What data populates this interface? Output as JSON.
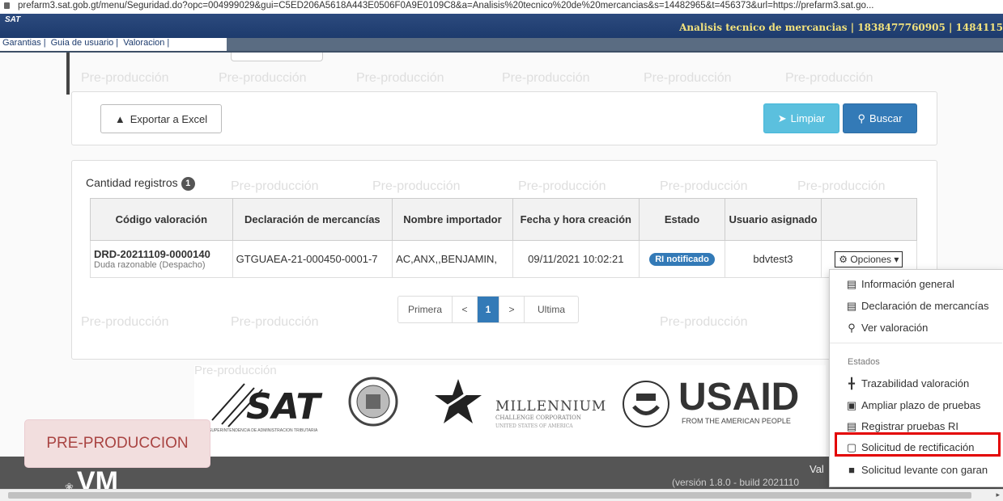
{
  "browser": {
    "url": "prefarm3.sat.gob.gt/menu/Seguridad.do?opc=004999029&gui=C5ED206A5618A443E0506F0A9E0109C8&a=Analisis%20tecnico%20de%20mercancias&s=14482965&t=456373&url=https://prefarm3.sat.go..."
  },
  "header": {
    "brand": "SAT",
    "title": "Analisis tecnico de mercancias | 1838477760905 | 1484115"
  },
  "menu": {
    "items": [
      "Garantias",
      "Guia de usuario",
      "Valoracion"
    ]
  },
  "watermark": "Pre-producción",
  "actions": {
    "export_label": "Exportar a Excel",
    "clear_label": "Limpiar",
    "search_label": "Buscar"
  },
  "results": {
    "count_label": "Cantidad registros",
    "count": "1",
    "columns": [
      "Código valoración",
      "Declaración de mercancías",
      "Nombre importador",
      "Fecha y hora creación",
      "Estado",
      "Usuario asignado",
      ""
    ],
    "rows": [
      {
        "codigo": "DRD-20211109-0000140",
        "tipo": "Duda razonable (Despacho)",
        "declaracion": "GTGUAEA-21-000450-0001-7",
        "importador": "AC,ANX,,BENJAMIN,",
        "fecha": "09/11/2021 10:02:21",
        "estado": "RI notificado",
        "usuario": "bdvtest3",
        "opciones": "Opciones"
      }
    ]
  },
  "pagination": {
    "first": "Primera",
    "prev": "<",
    "current": "1",
    "next": ">",
    "last": "Ultima"
  },
  "dropdown": {
    "items": [
      {
        "label": "Información general",
        "icon": "list-alt-icon"
      },
      {
        "label": "Declaración de mercancías",
        "icon": "list-icon"
      },
      {
        "label": "Ver valoración",
        "icon": "search-icon"
      }
    ],
    "section_header": "Estados",
    "state_items": [
      {
        "label": "Trazabilidad valoración",
        "icon": "tower-icon"
      },
      {
        "label": "Ampliar plazo de pruebas",
        "icon": "calendar-plus-icon"
      },
      {
        "label": "Registrar pruebas RI",
        "icon": "list-icon"
      },
      {
        "label": "Solicitud de rectificación",
        "icon": "file-icon"
      },
      {
        "label": "Solicitud levante con garan",
        "icon": "file-filled-icon"
      }
    ]
  },
  "footer": {
    "logos": {
      "sat": "SAT",
      "sat_sub": "SUPERINTENDENCIA DE ADMINISTRACION TRIBUTARIA",
      "millennium": "MILLENNIUM",
      "millennium_sub": "CHALLENGE CORPORATION",
      "millennium_sub2": "UNITED STATES OF AMERICA",
      "usaid": "USAID",
      "usaid_sub": "FROM THE AMERICAN PEOPLE",
      "vm": "VM"
    },
    "version_prefix": "Val",
    "version": "(versión 1.8.0 - build 2021110"
  },
  "pre_produccion_badge": "PRE-PRODUCCION"
}
